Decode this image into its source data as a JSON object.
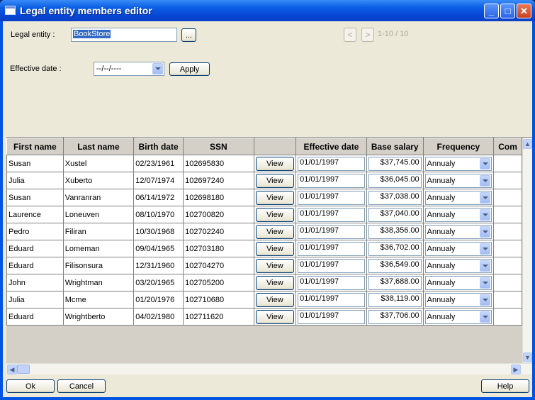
{
  "window": {
    "title": "Legal entity members editor"
  },
  "title_buttons": {
    "minimize": "_",
    "maximize": "□",
    "close": "✕"
  },
  "form": {
    "legal_entity_label": "Legal entity :",
    "legal_entity_value": "BookStore",
    "browse_label": "...",
    "effective_date_label": "Effective date :",
    "effective_date_value": "--/--/----",
    "apply_label": "Apply",
    "page_info": "1-10 / 10",
    "prev_glyph": "<",
    "next_glyph": ">"
  },
  "grid": {
    "columns": [
      "First name",
      "Last name",
      "Birth date",
      "SSN",
      "",
      "Effective date",
      "Base salary",
      "Frequency",
      "Com"
    ],
    "view_label": "View",
    "rows": [
      {
        "first": "Susan",
        "last": "Xustel",
        "birth": "02/23/1961",
        "ssn": "102695830",
        "eff": "01/01/1997",
        "salary": "$37,745.00",
        "freq": "Annualy"
      },
      {
        "first": "Julia",
        "last": "Xuberto",
        "birth": "12/07/1974",
        "ssn": "102697240",
        "eff": "01/01/1997",
        "salary": "$36,045.00",
        "freq": "Annualy"
      },
      {
        "first": "Susan",
        "last": "Vanranran",
        "birth": "06/14/1972",
        "ssn": "102698180",
        "eff": "01/01/1997",
        "salary": "$37,038.00",
        "freq": "Annualy"
      },
      {
        "first": "Laurence",
        "last": "Loneuven",
        "birth": "08/10/1970",
        "ssn": "102700820",
        "eff": "01/01/1997",
        "salary": "$37,040.00",
        "freq": "Annualy"
      },
      {
        "first": "Pedro",
        "last": "Filiran",
        "birth": "10/30/1968",
        "ssn": "102702240",
        "eff": "01/01/1997",
        "salary": "$38,356.00",
        "freq": "Annualy"
      },
      {
        "first": "Eduard",
        "last": "Lomeman",
        "birth": "09/04/1965",
        "ssn": "102703180",
        "eff": "01/01/1997",
        "salary": "$36,702.00",
        "freq": "Annualy"
      },
      {
        "first": "Eduard",
        "last": "Filisonsura",
        "birth": "12/31/1960",
        "ssn": "102704270",
        "eff": "01/01/1997",
        "salary": "$36,549.00",
        "freq": "Annualy"
      },
      {
        "first": "John",
        "last": "Wrightman",
        "birth": "03/20/1965",
        "ssn": "102705200",
        "eff": "01/01/1997",
        "salary": "$37,688.00",
        "freq": "Annualy"
      },
      {
        "first": "Julia",
        "last": "Mcme",
        "birth": "01/20/1976",
        "ssn": "102710680",
        "eff": "01/01/1997",
        "salary": "$38,119.00",
        "freq": "Annualy"
      },
      {
        "first": "Eduard",
        "last": "Wrightberto",
        "birth": "04/02/1980",
        "ssn": "102711620",
        "eff": "01/01/1997",
        "salary": "$37,706.00",
        "freq": "Annualy"
      }
    ]
  },
  "footer": {
    "ok_label": "Ok",
    "cancel_label": "Cancel",
    "help_label": "Help"
  },
  "colors": {
    "titlebar": "#0054e3",
    "dialog_bg": "#ece9d8",
    "selection": "#316ac5"
  }
}
